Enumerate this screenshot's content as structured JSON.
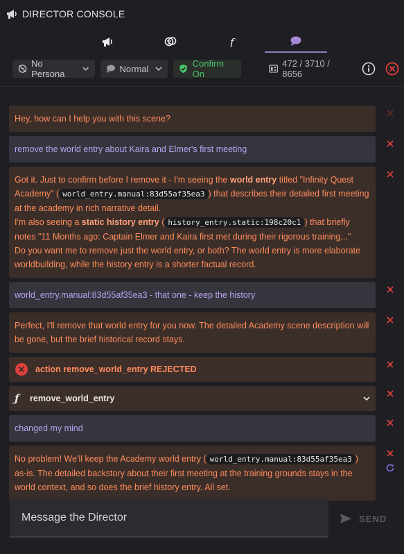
{
  "header": {
    "title": "DIRECTOR CONSOLE",
    "icon": "megaphone-icon"
  },
  "tabs": [
    {
      "icon": "megaphone-icon",
      "active": false
    },
    {
      "icon": "theater-masks-icon",
      "active": false
    },
    {
      "icon": "function-icon",
      "active": false
    },
    {
      "icon": "chat-bubble-icon",
      "active": true
    }
  ],
  "toolbar": {
    "persona_label": "No Persona",
    "mode_label": "Normal",
    "confirm_label": "Confirm On",
    "token_stats": "472 / 3710 / 8656"
  },
  "messages": {
    "m1": {
      "text": "Hey, how can I help you with this scene?"
    },
    "m2": {
      "text": "remove the world entry about Kaira and Elmer's first meeting"
    },
    "m3": {
      "p1": "Got it. Just to confirm before I remove it - I'm seeing the ",
      "b1": "world entry",
      "p2": " titled \"Infinity Quest Academy\" (",
      "c1": "world_entry.manual:83d55af35ea3",
      "p3": ") that describes their detailed first meeting at the academy in rich narrative detail.",
      "p4": "I'm also seeing a ",
      "b2": "static history entry",
      "p5": " (",
      "c2": "history_entry.static:198c20c1",
      "p6": ") that briefly notes \"11 Months ago: Captain Elmer and Kaira first met during their rigorous training...\"",
      "p7": "Do you want me to remove just the world entry, or both? The world entry is more elaborate worldbuilding, while the history entry is a shorter factual record."
    },
    "m4": {
      "text": "world_entry.manual:83d55af35ea3 - that one - keep the history"
    },
    "m5": {
      "text": "Perfect, I'll remove that world entry for you now. The detailed Academy scene description will be gone, but the brief historical record stays."
    },
    "m6": {
      "text": "action remove_world_entry REJECTED"
    },
    "m7": {
      "text": "remove_world_entry"
    },
    "m8": {
      "text": "changed my mind"
    },
    "m9": {
      "p1": "No problem! We'll keep the Academy world entry (",
      "c1": "world_entry.manual:83d55af35ea3",
      "p2": ") as-is. The detailed backstory about their first meeting at the training grounds stays in the world context, and so does the brief history entry. All set."
    }
  },
  "input": {
    "placeholder": "Message the Director"
  },
  "send": {
    "label": "SEND"
  },
  "colors": {
    "accent": "#8e7cc3",
    "director_text": "#ff8c5c",
    "user_text": "#b9a2f0",
    "danger": "#e0403c",
    "success": "#4cc26a"
  }
}
